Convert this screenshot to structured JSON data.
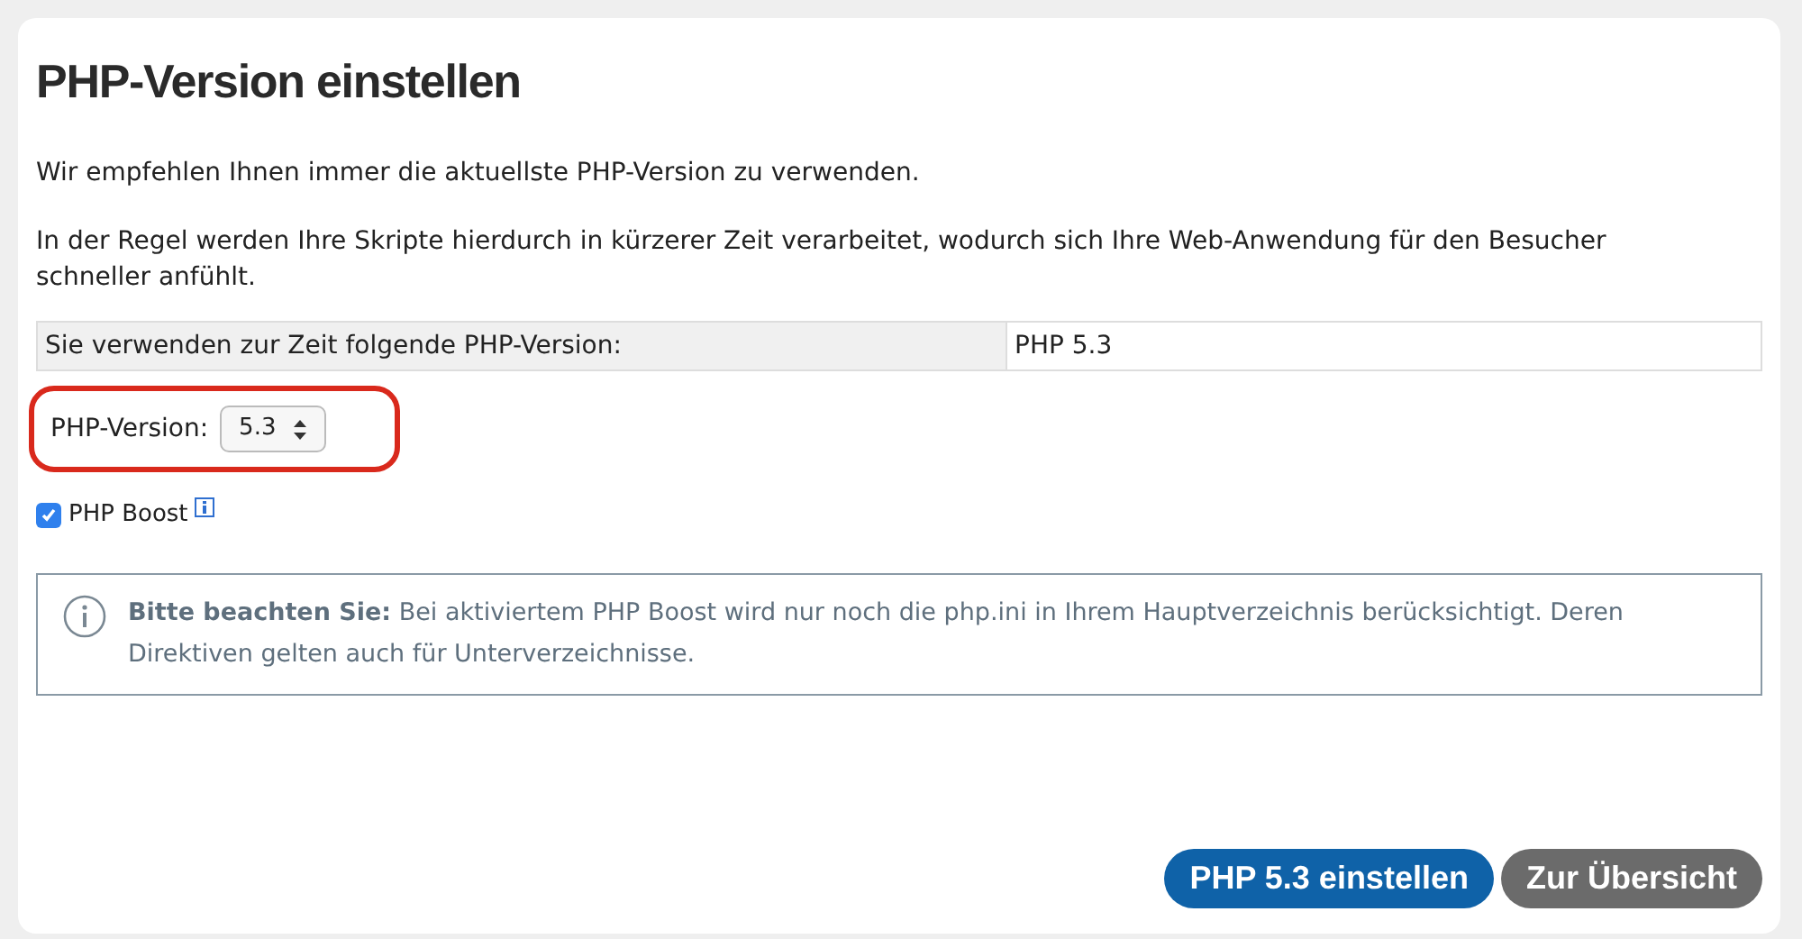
{
  "title": "PHP-Version einstellen",
  "paragraphs": [
    "Wir empfehlen Ihnen immer die aktuellste PHP-Version zu verwenden.",
    "In der Regel werden Ihre Skripte hierdurch in kürzerer Zeit verarbeitet, wodurch sich Ihre Web-Anwendung für den Besucher schneller anfühlt."
  ],
  "current": {
    "label": "Sie verwenden zur Zeit folgende PHP-Version:",
    "value": "PHP 5.3"
  },
  "version_select": {
    "label": "PHP-Version:",
    "value": "5.3"
  },
  "boost": {
    "label": "PHP Boost",
    "checked": true
  },
  "notice": "**Bitte beachten Sie:** Bei aktiviertem PHP Boost wird nur noch die php.ini in Ihrem Hauptverzeichnis berücksichtigt. Deren Direktiven gelten auch für Unterverzeichnisse.",
  "buttons": [
    {
      "label": "PHP 5.3 einstellen",
      "kind": "primary"
    },
    {
      "label": "Zur Übersicht",
      "kind": "secondary"
    }
  ]
}
